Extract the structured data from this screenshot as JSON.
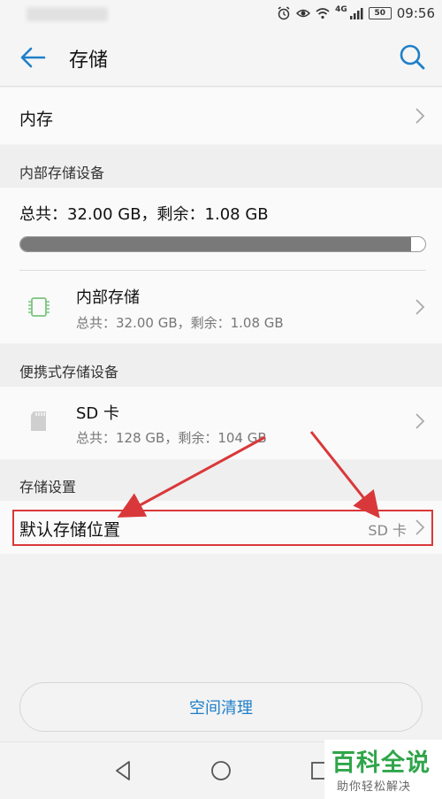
{
  "status_bar": {
    "network": "4G",
    "battery": "50",
    "time": "09:56"
  },
  "app_bar": {
    "title": "存储",
    "back_icon": "arrow-left-icon",
    "search_icon": "search-icon"
  },
  "memory_row": {
    "label": "内存"
  },
  "internal_section": {
    "header": "内部存储设备",
    "totals": "总共：32.00 GB，剩余：1.08 GB",
    "used_fraction": 0.966,
    "item": {
      "title": "内部存储",
      "subtitle": "总共：32.00 GB，剩余：1.08 GB",
      "icon": "chip-icon"
    }
  },
  "portable_section": {
    "header": "便携式存储设备",
    "item": {
      "title": "SD 卡",
      "subtitle": "总共：128 GB，剩余：104 GB",
      "icon": "sd-card-icon"
    }
  },
  "settings_section": {
    "header": "存储设置",
    "default_location": {
      "label": "默认存储位置",
      "value": "SD 卡"
    }
  },
  "clean_button": {
    "label": "空间清理"
  },
  "watermark": {
    "title": "百科全说",
    "subtitle": "助你轻松解决"
  },
  "colors": {
    "accent": "#1f7fc9",
    "annotation": "#d9383a",
    "watermark_green": "#2fa54a"
  }
}
